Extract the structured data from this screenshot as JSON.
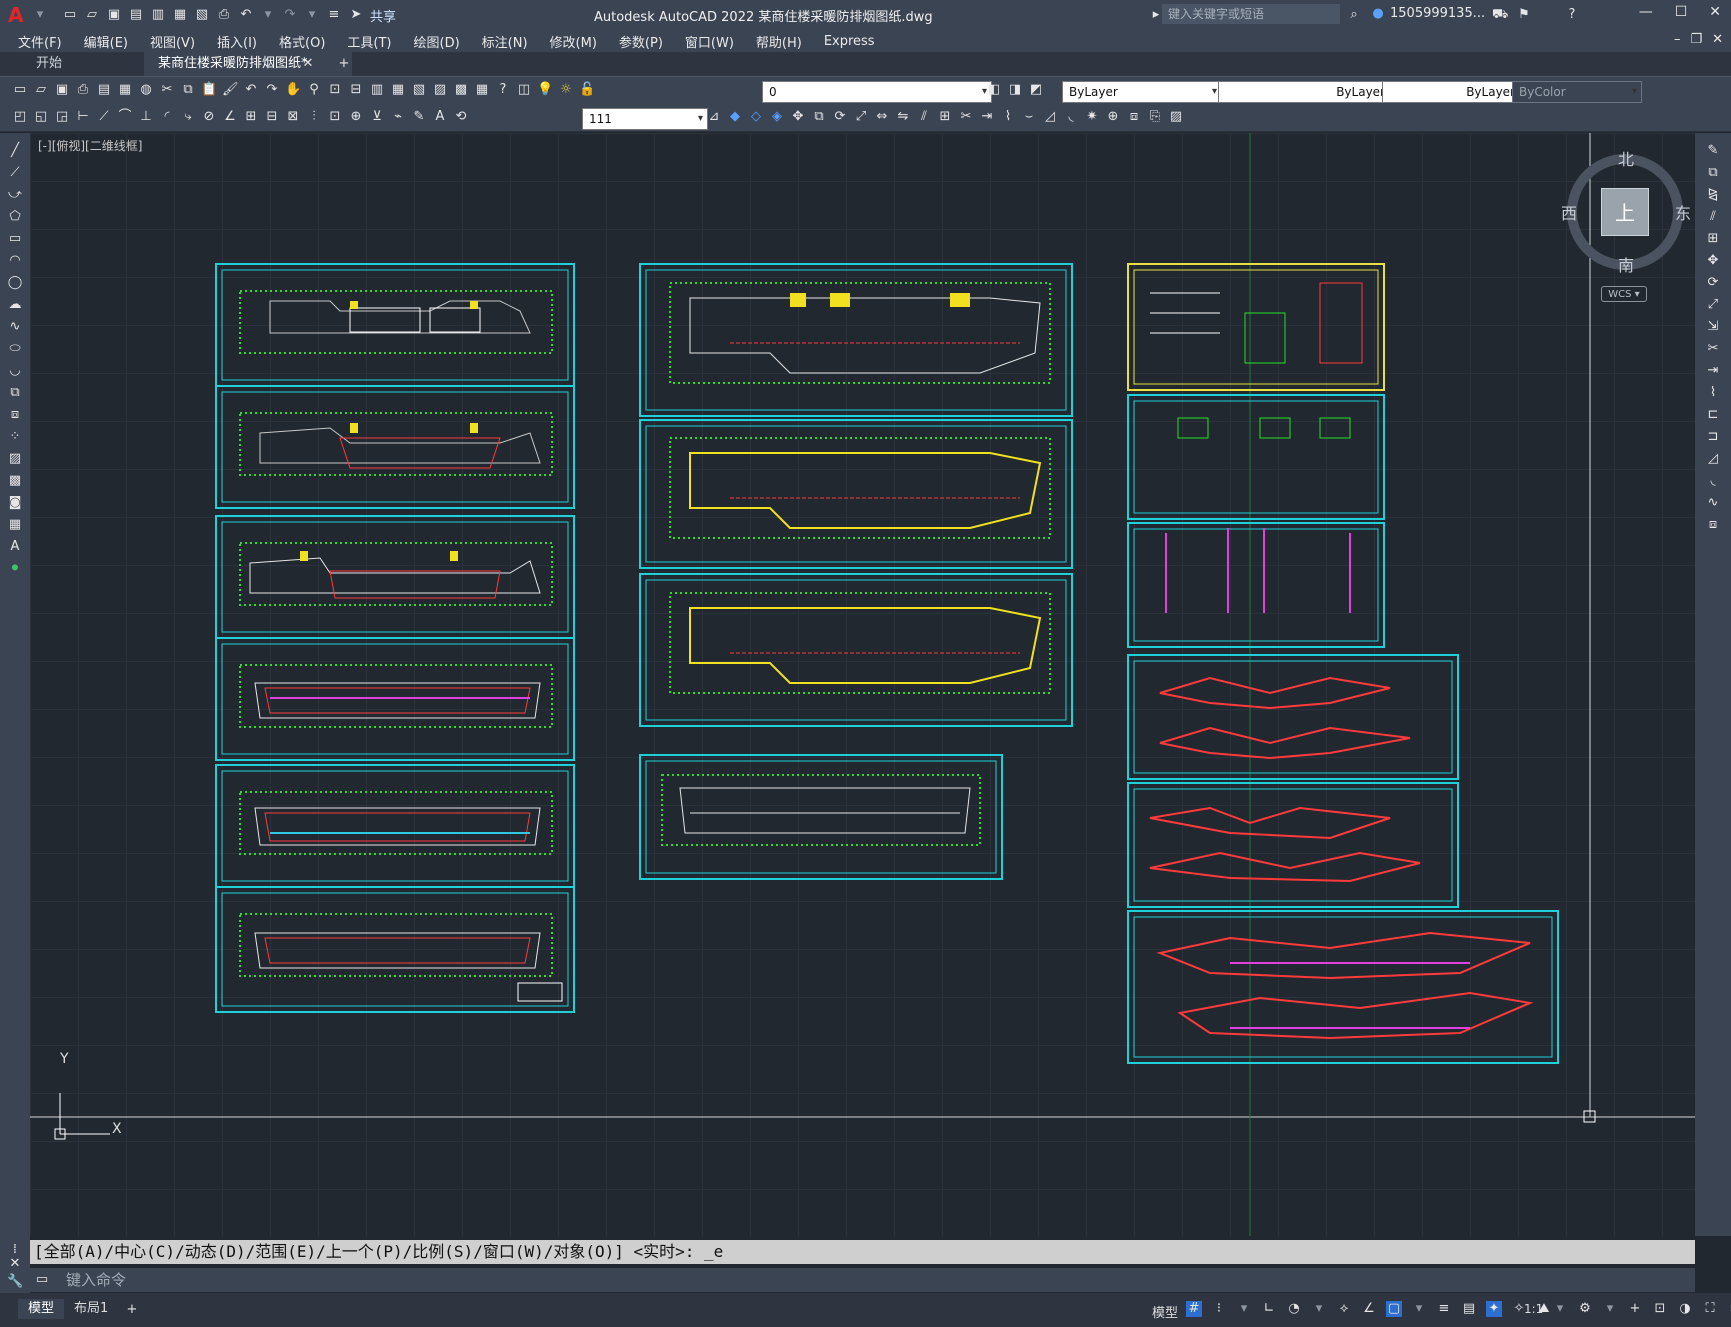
{
  "app": {
    "logo": "A",
    "title": "Autodesk AutoCAD 2022    某商住楼采暖防排烟图纸.dwg",
    "share_label": "共享",
    "search_placeholder": "键入关键字或短语",
    "user": "1505999135...",
    "window_buttons": [
      "—",
      "☐",
      "✕"
    ]
  },
  "menu": {
    "items": [
      "文件(F)",
      "编辑(E)",
      "视图(V)",
      "插入(I)",
      "格式(O)",
      "工具(T)",
      "绘图(D)",
      "标注(N)",
      "修改(M)",
      "参数(P)",
      "窗口(W)",
      "帮助(H)",
      "Express"
    ]
  },
  "tabs": {
    "start": "开始",
    "file": "某商住楼采暖防排烟图纸*",
    "close": "✕",
    "add": "+"
  },
  "toolbar": {
    "layer_value": "0",
    "color": "ByLayer",
    "linetype": "ByLayer",
    "lineweight": "ByLayer",
    "plotstyle": "ByColor",
    "dimstyle": "111"
  },
  "viewport": {
    "label": "[-][俯视][二维线框]",
    "compass": {
      "north": "北",
      "south": "南",
      "east": "东",
      "west": "西",
      "top": "上"
    },
    "wcs": "WCS ▾",
    "ucs_y": "Y",
    "ucs_x": "X"
  },
  "command": {
    "history": "[全部(A)/中心(C)/动态(D)/范围(E)/上一个(P)/比例(S)/窗口(W)/对象(O)] <实时>: _e",
    "placeholder": "键入命令"
  },
  "status": {
    "tab_model": "模型",
    "tab_layout": "布局1",
    "add": "+",
    "model_label": "模型",
    "scale": "1:1"
  },
  "colors": {
    "sheet_border": "#20d0d8",
    "sheet_highlight": "#e8e040",
    "background": "#212830"
  }
}
